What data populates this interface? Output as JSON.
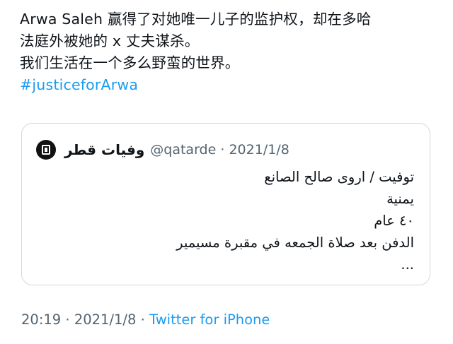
{
  "tweet": {
    "lines": [
      "Arwa Saleh 赢得了对她唯一儿子的监护权，却在多哈",
      "法庭外被她的 x 丈夫谋杀。",
      "我们生活在一个多么野蛮的世界。"
    ],
    "hashtag": "#justiceforArwa"
  },
  "quote": {
    "author_name": "وفيات قطر",
    "handle": "@qatarde",
    "separator": "·",
    "date": "2021/1/8",
    "lines": [
      "توفيت / اروى صالح الصانع",
      "يمنية",
      "٤٠ عام",
      "الدفن بعد صلاة الجمعه في مقبرة مسيمير",
      "..."
    ],
    "avatar_icon": "qatar-obituaries-logo-icon"
  },
  "footer": {
    "time": "20:19",
    "separator": "·",
    "date": "2021/1/8",
    "separator2": "·",
    "source": "Twitter for iPhone"
  },
  "colors": {
    "link": "#1d9bf0",
    "secondary_text": "#536471",
    "border": "#cfd9de"
  }
}
